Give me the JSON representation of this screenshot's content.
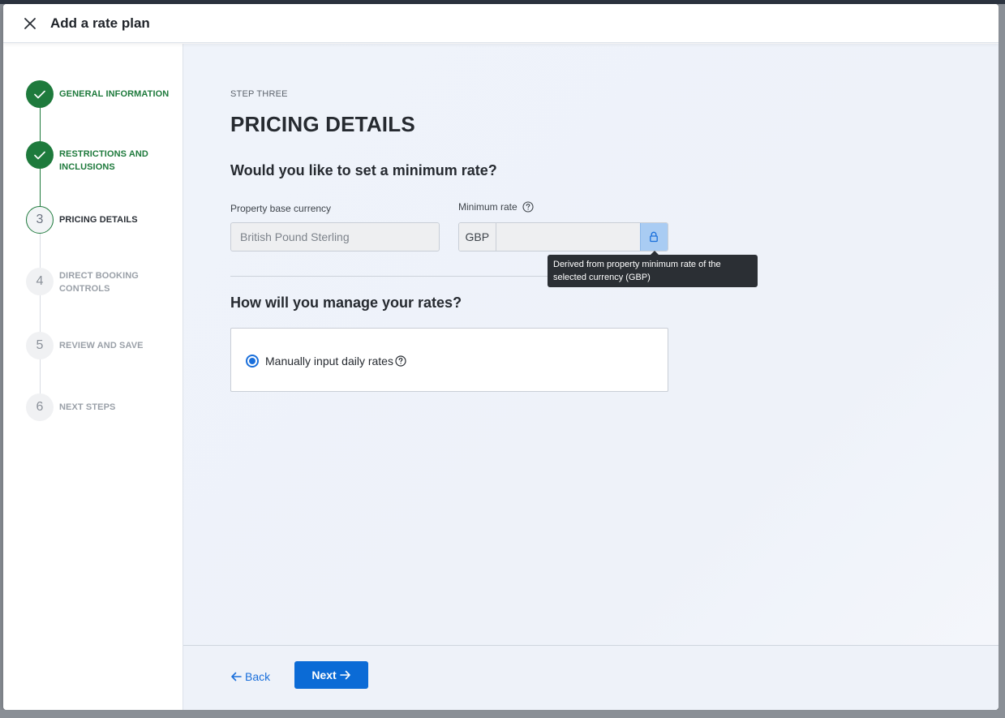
{
  "modal": {
    "title": "Add a rate plan"
  },
  "stepper": {
    "steps": [
      {
        "number": "",
        "label": "GENERAL INFORMATION",
        "state": "done"
      },
      {
        "number": "",
        "label": "RESTRICTIONS AND INCLUSIONS",
        "state": "done"
      },
      {
        "number": "3",
        "label": "PRICING DETAILS",
        "state": "current"
      },
      {
        "number": "4",
        "label": "DIRECT BOOKING CONTROLS",
        "state": "todo"
      },
      {
        "number": "5",
        "label": "REVIEW AND SAVE",
        "state": "todo"
      },
      {
        "number": "6",
        "label": "NEXT STEPS",
        "state": "todo"
      }
    ]
  },
  "main": {
    "eyebrow": "STEP THREE",
    "title": "PRICING DETAILS",
    "min_rate_question": "Would you like to set a minimum rate?",
    "base_currency_label": "Property base currency",
    "base_currency_value": "British Pound Sterling",
    "min_rate_label": "Minimum rate",
    "min_rate_prefix": "GBP",
    "min_rate_value": "",
    "tooltip": "Derived from property minimum rate of the selected currency (GBP)",
    "manage_question": "How will you manage your rates?",
    "option_manual": "Manually input daily rates"
  },
  "footer": {
    "back_label": "Back",
    "next_label": "Next"
  },
  "colors": {
    "success": "#1e7a3c",
    "primary": "#0b6bd6",
    "link": "#1a6fdb"
  }
}
